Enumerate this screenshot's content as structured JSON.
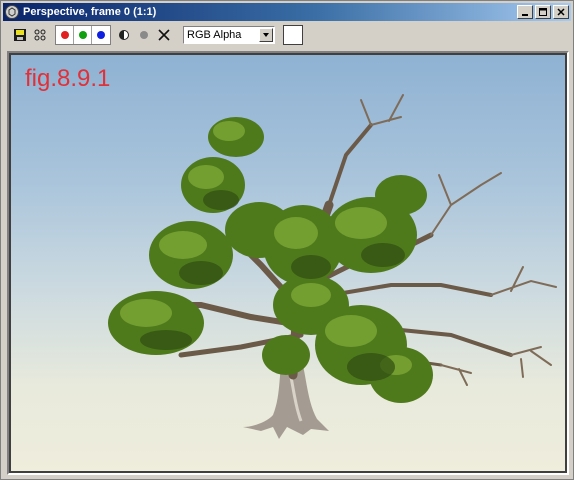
{
  "window": {
    "title": "Perspective, frame 0 (1:1)",
    "icon": "3dsmax-logo-icon",
    "buttons": [
      "minimize-icon",
      "maximize-icon",
      "close-icon"
    ]
  },
  "toolbar": {
    "tools": [
      "save-icon",
      "clone-icon"
    ],
    "channels": [
      {
        "name": "red-channel",
        "color": "#e02020"
      },
      {
        "name": "green-channel",
        "color": "#10a010"
      },
      {
        "name": "blue-channel",
        "color": "#1020e0"
      }
    ],
    "extra_tools": [
      "mono-icon",
      "alpha-dot-icon",
      "clear-icon"
    ],
    "channel_select": "RGB Alpha",
    "swatch_color": "#ffffff"
  },
  "viewport": {
    "label": "fig.8.9.1",
    "label_color": "#e23038"
  }
}
